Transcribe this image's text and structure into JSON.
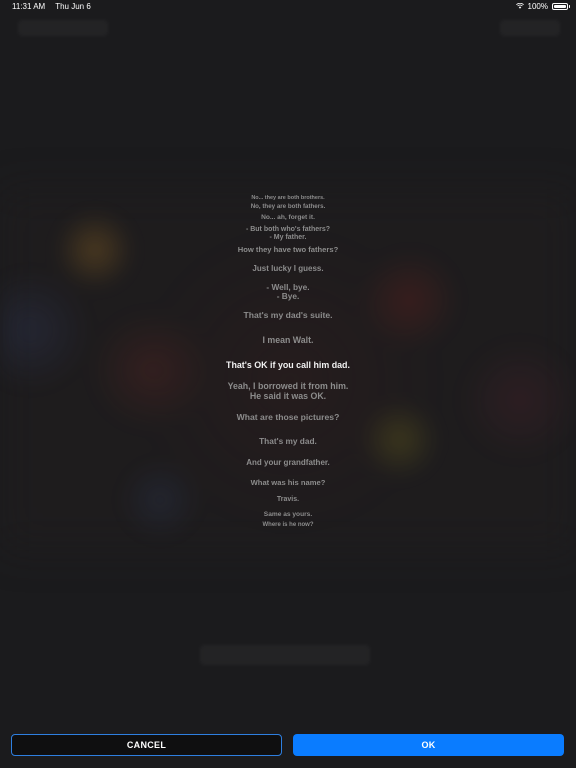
{
  "status_bar": {
    "time": "11:31 AM",
    "date": "Thu Jun 6",
    "battery": "100%",
    "battery_level": 1.0
  },
  "subtitles": [
    {
      "text": "",
      "current": false
    },
    {
      "text": "",
      "current": false
    },
    {
      "text": "No... they are both brothers.",
      "current": false
    },
    {
      "text": "No, they are both fathers.",
      "current": false
    },
    {
      "text": "No... ah, forget it.",
      "current": false
    },
    {
      "text": "- But both who's fathers?\n- My father.",
      "current": false
    },
    {
      "text": "How they have two fathers?",
      "current": false
    },
    {
      "text": "Just lucky I guess.",
      "current": false
    },
    {
      "text": "- Well, bye.\n- Bye.",
      "current": false
    },
    {
      "text": "That's my dad's suite.",
      "current": false
    },
    {
      "text": "I mean Walt.",
      "current": false
    },
    {
      "text": "That's OK if you call him dad.",
      "current": true
    },
    {
      "text": "Yeah, I borrowed it from him.\nHe said it was OK.",
      "current": false
    },
    {
      "text": "What are those pictures?",
      "current": false
    },
    {
      "text": "That's my dad.",
      "current": false
    },
    {
      "text": "And your grandfather.",
      "current": false
    },
    {
      "text": "What was his name?",
      "current": false
    },
    {
      "text": "Travis.",
      "current": false
    },
    {
      "text": "Same as yours.",
      "current": false
    },
    {
      "text": "Where is he now?",
      "current": false
    },
    {
      "text": "",
      "current": false
    },
    {
      "text": "",
      "current": false
    }
  ],
  "buttons": {
    "cancel": "CANCEL",
    "ok": "OK"
  }
}
